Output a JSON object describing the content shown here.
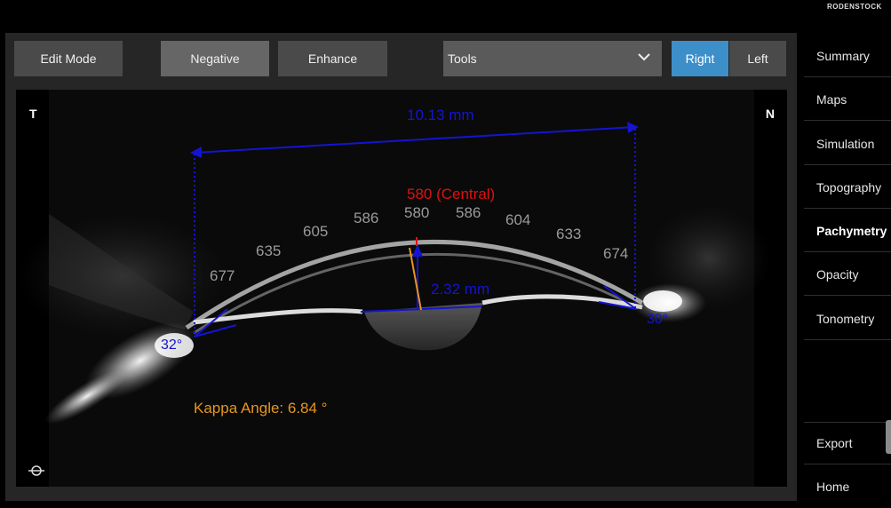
{
  "brand": {
    "logo_text": "RODENSTOCK"
  },
  "toolbar": {
    "edit_mode": "Edit Mode",
    "negative": "Negative",
    "enhance": "Enhance",
    "tools": {
      "selected": "Tools"
    },
    "eye_right": "Right",
    "eye_left": "Left",
    "active_eye": "Right"
  },
  "image": {
    "side_left": "T",
    "side_right": "N",
    "chamber_width": "10.13 mm",
    "central_label": "580 (Central)",
    "chamber_depth": "2.32 mm",
    "angle_left": "32°",
    "angle_right": "30°",
    "kappa": "Kappa Angle: 6.84 °",
    "thickness_values": [
      "677",
      "635",
      "605",
      "586",
      "580",
      "586",
      "604",
      "633",
      "674"
    ],
    "colors": {
      "measure": "#1414d2",
      "central": "#e01010",
      "kappa": "#e8961e",
      "thickness": "#9a9a9a"
    }
  },
  "sidebar": {
    "items": [
      {
        "label": "Summary"
      },
      {
        "label": "Maps"
      },
      {
        "label": "Simulation"
      },
      {
        "label": "Topography"
      },
      {
        "label": "Pachymetry",
        "active": true
      },
      {
        "label": "Opacity"
      },
      {
        "label": "Tonometry"
      }
    ],
    "export": "Export",
    "home": "Home"
  }
}
